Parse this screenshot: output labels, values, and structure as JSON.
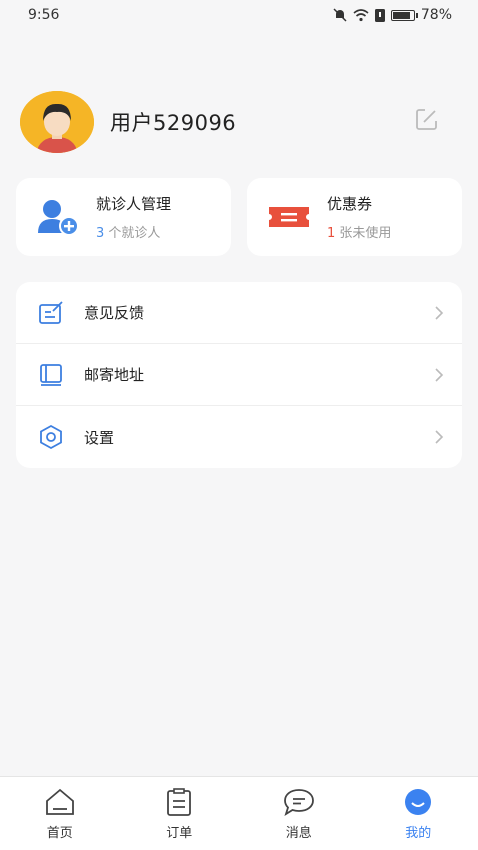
{
  "status": {
    "time": "9:56",
    "battery": "78%"
  },
  "profile": {
    "username": "用户529096"
  },
  "cards": [
    {
      "title": "就诊人管理",
      "count": "3",
      "suffix": " 个就诊人"
    },
    {
      "title": "优惠券",
      "count": "1",
      "suffix": " 张未使用"
    }
  ],
  "menu": [
    {
      "label": "意见反馈",
      "icon": "feedback-icon"
    },
    {
      "label": "邮寄地址",
      "icon": "address-book-icon"
    },
    {
      "label": "设置",
      "icon": "settings-hexagon-icon"
    }
  ],
  "tabs": [
    {
      "label": "首页",
      "icon": "home-icon",
      "active": false
    },
    {
      "label": "订单",
      "icon": "clipboard-icon",
      "active": false
    },
    {
      "label": "消息",
      "icon": "chat-bubble-icon",
      "active": false
    },
    {
      "label": "我的",
      "icon": "smile-face-icon",
      "active": true
    }
  ],
  "colors": {
    "accent": "#3b82f0",
    "coupon_red": "#e8503c",
    "count_blue": "#4a8ee8"
  }
}
